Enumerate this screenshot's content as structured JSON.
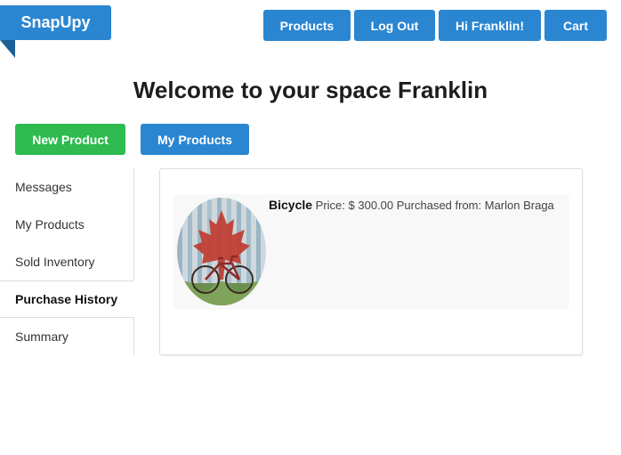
{
  "header": {
    "brand": "SnapUpy",
    "nav": {
      "products": "Products",
      "logout": "Log Out",
      "greeting": "Hi Franklin!",
      "cart": "Cart"
    }
  },
  "main": {
    "title": "Welcome to your space Franklin",
    "actions": {
      "new_product": "New Product",
      "my_products": "My Products"
    }
  },
  "sidebar": {
    "items": [
      {
        "label": "Messages"
      },
      {
        "label": "My Products"
      },
      {
        "label": "Sold Inventory"
      },
      {
        "label": "Purchase History",
        "active": true
      },
      {
        "label": "Summary"
      }
    ]
  },
  "purchases": [
    {
      "name": "Bicycle",
      "price": "Price: $ 300.00",
      "seller": "Purchased from: Marlon Braga"
    }
  ],
  "colors": {
    "primary": "#2a86d1",
    "success": "#2fbb4f"
  }
}
